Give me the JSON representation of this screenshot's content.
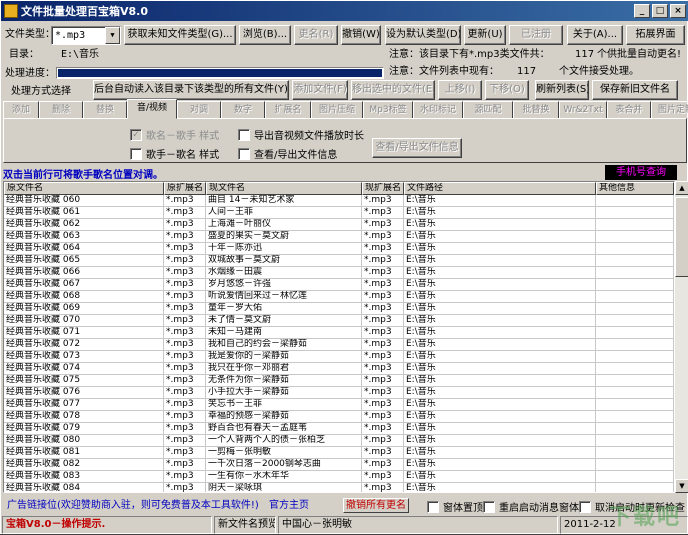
{
  "window": {
    "title": "文件批量处理百宝箱V8.0",
    "controls": [
      "_",
      "□",
      "×"
    ]
  },
  "toolbar": {
    "filetype_label": "文件类型：",
    "filetype_value": "*.mp3",
    "get_unknown": "获取未知文件类型(G)...",
    "browse": "浏览(B)...",
    "rename": "更名(R)",
    "undo": "撤销(W)",
    "set_default": "设为默认类型(D)",
    "update": "更新(U)",
    "registered": "已注册",
    "about": "关于(A)...",
    "expand": "拓展界面"
  },
  "dir": {
    "label": "目录：",
    "value": "E:\\音乐",
    "note_left": "注意：该目录下有*.mp3类文件共：",
    "count": "117",
    "note_right": "个供批量自动更名!"
  },
  "progress": {
    "label": "处理进度：",
    "fraction": 1.0,
    "note_left": "注意：文件列表中现有：",
    "count": "117",
    "note_right": "个文件接受处理。"
  },
  "mode": {
    "label": "处理方式选择",
    "read_all": "后台自动读入该目录下该类型的所有文件(Y)",
    "add_file": "添加文件(F)",
    "remove_selected": "移出选中的文件(E)",
    "up": "上移(I)",
    "down": "下移(O)",
    "refresh": "刷新列表(S)",
    "save_old": "保存新旧文件名"
  },
  "tabs": [
    {
      "label": "添加",
      "active": false
    },
    {
      "label": "删除",
      "active": false
    },
    {
      "label": "替换",
      "active": false
    },
    {
      "label": "音/视频",
      "active": true
    },
    {
      "label": "对调",
      "active": false
    },
    {
      "label": "数字",
      "active": false
    },
    {
      "label": "扩展名",
      "active": false
    },
    {
      "label": "图片压缩",
      "active": false
    },
    {
      "label": "Mp3标签",
      "active": false
    },
    {
      "label": "水印标记",
      "active": false
    },
    {
      "label": "源匹配",
      "active": false
    },
    {
      "label": "批替换",
      "active": false
    },
    {
      "label": "Wr&2Txt",
      "active": false
    },
    {
      "label": "表合并",
      "active": false
    },
    {
      "label": "图片定制",
      "active": false
    }
  ],
  "panel": {
    "opt1": "歌名－歌手 样式",
    "opt2": "歌手－歌名 样式",
    "opt3": "导出音视频文件播放时长",
    "opt4": "查看/导出文件信息",
    "view_btn": "查看/导出文件信息"
  },
  "hint": "双击当前行可将歌手歌名位置对调。",
  "phone_query": "手机号查询",
  "grid": {
    "headers": [
      "原文件名",
      "原扩展名",
      "现文件名",
      "现扩展名",
      "文件路径",
      "其他信息"
    ],
    "rows": [
      [
        "经典音乐收藏 060",
        "*.mp3",
        "曲目 14－未知艺术家",
        "*.mp3",
        "E:\\音乐",
        ""
      ],
      [
        "经典音乐收藏 061",
        "*.mp3",
        "人间－王菲",
        "*.mp3",
        "E:\\音乐",
        ""
      ],
      [
        "经典音乐收藏 062",
        "*.mp3",
        "上海滩－叶丽仪",
        "*.mp3",
        "E:\\音乐",
        ""
      ],
      [
        "经典音乐收藏 063",
        "*.mp3",
        "盛夏的果实－莫文蔚",
        "*.mp3",
        "E:\\音乐",
        ""
      ],
      [
        "经典音乐收藏 064",
        "*.mp3",
        "十年－陈亦迅",
        "*.mp3",
        "E:\\音乐",
        ""
      ],
      [
        "经典音乐收藏 065",
        "*.mp3",
        "双城故事－莫文蔚",
        "*.mp3",
        "E:\\音乐",
        ""
      ],
      [
        "经典音乐收藏 066",
        "*.mp3",
        "水烟缘－田震",
        "*.mp3",
        "E:\\音乐",
        ""
      ],
      [
        "经典音乐收藏 067",
        "*.mp3",
        "岁月悠悠－许强",
        "*.mp3",
        "E:\\音乐",
        ""
      ],
      [
        "经典音乐收藏 068",
        "*.mp3",
        "听说爱情回来过－林忆莲",
        "*.mp3",
        "E:\\音乐",
        ""
      ],
      [
        "经典音乐收藏 069",
        "*.mp3",
        "童年－罗大佑",
        "*.mp3",
        "E:\\音乐",
        ""
      ],
      [
        "经典音乐收藏 070",
        "*.mp3",
        "未了情－莫文蔚",
        "*.mp3",
        "E:\\音乐",
        ""
      ],
      [
        "经典音乐收藏 071",
        "*.mp3",
        "未知－马建南",
        "*.mp3",
        "E:\\音乐",
        ""
      ],
      [
        "经典音乐收藏 072",
        "*.mp3",
        "我和自己的约会－梁静茹",
        "*.mp3",
        "E:\\音乐",
        ""
      ],
      [
        "经典音乐收藏 073",
        "*.mp3",
        "我是爱你的－梁静茹",
        "*.mp3",
        "E:\\音乐",
        ""
      ],
      [
        "经典音乐收藏 074",
        "*.mp3",
        "我只在乎你－邓丽君",
        "*.mp3",
        "E:\\音乐",
        ""
      ],
      [
        "经典音乐收藏 075",
        "*.mp3",
        "无条件为你－梁静茹",
        "*.mp3",
        "E:\\音乐",
        ""
      ],
      [
        "经典音乐收藏 076",
        "*.mp3",
        "小手拉大手－梁静茹",
        "*.mp3",
        "E:\\音乐",
        ""
      ],
      [
        "经典音乐收藏 077",
        "*.mp3",
        "笑忘书－王菲",
        "*.mp3",
        "E:\\音乐",
        ""
      ],
      [
        "经典音乐收藏 078",
        "*.mp3",
        "幸福的预感－梁静茹",
        "*.mp3",
        "E:\\音乐",
        ""
      ],
      [
        "经典音乐收藏 079",
        "*.mp3",
        "野百合也有春天－孟庭苇",
        "*.mp3",
        "E:\\音乐",
        ""
      ],
      [
        "经典音乐收藏 080",
        "*.mp3",
        "一个人背两个人的债－张柏芝",
        "*.mp3",
        "E:\\音乐",
        ""
      ],
      [
        "经典音乐收藏 081",
        "*.mp3",
        "一剪梅－张明敏",
        "*.mp3",
        "E:\\音乐",
        ""
      ],
      [
        "经典音乐收藏 082",
        "*.mp3",
        "一千次日落－2000钢琴志曲",
        "*.mp3",
        "E:\\音乐",
        ""
      ],
      [
        "经典音乐收藏 083",
        "*.mp3",
        "一生有你－水木年华",
        "*.mp3",
        "E:\\音乐",
        ""
      ],
      [
        "经典音乐收藏 084",
        "*.mp3",
        "阴天－梁咏琪",
        "*.mp3",
        "E:\\音乐",
        ""
      ],
      [
        "经典音乐收藏 085",
        "*.mp3",
        "阴天－莫文蔚",
        "*.mp3",
        "E:\\音乐",
        ""
      ]
    ]
  },
  "bottom": {
    "ad": "广告链接位(欢迎赞助商入驻，则可免费普及本工具软件!)",
    "site": "官方主页",
    "cancel_all": "撤销所有更名",
    "topmost": "窗体置顶",
    "restart_tray": "重启启动消息窗体",
    "cancel_update": "取消启动时更新检查"
  },
  "statusbar": {
    "tip": "宝箱V8.0－操作提示.",
    "preview_label": "新文件名预览",
    "preview_value": "中国心－张明敏",
    "time": "2011-2-12"
  },
  "watermark": "下载吧",
  "colors": {
    "title_start": "#0a246a",
    "title_end": "#3a6ea5",
    "hint": "#0000c0",
    "phone_fg": "#ff00ff",
    "red": "#c00000"
  }
}
